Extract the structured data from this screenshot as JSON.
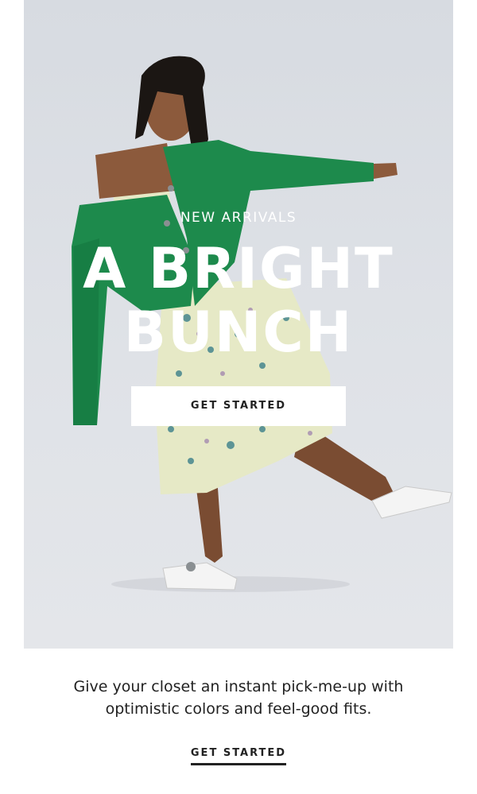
{
  "hero": {
    "image_description_icon": "model-photo",
    "eyebrow": "NEW ARRIVALS",
    "headline_line1": "A BRIGHT",
    "headline_line2": "BUNCH",
    "cta_label": "GET STARTED",
    "colors": {
      "background": "#dcdfe4",
      "cardigan": "#1d8a4c",
      "dress": "#e6e9c6",
      "skin": "#8c5a3c",
      "cta_bg": "#ffffff",
      "cta_text": "#222222"
    }
  },
  "body": {
    "line1": "Give your closet an instant pick-me-up with",
    "line2": "optimistic colors and feel-good fits."
  },
  "footer_cta": {
    "label": "GET STARTED"
  }
}
